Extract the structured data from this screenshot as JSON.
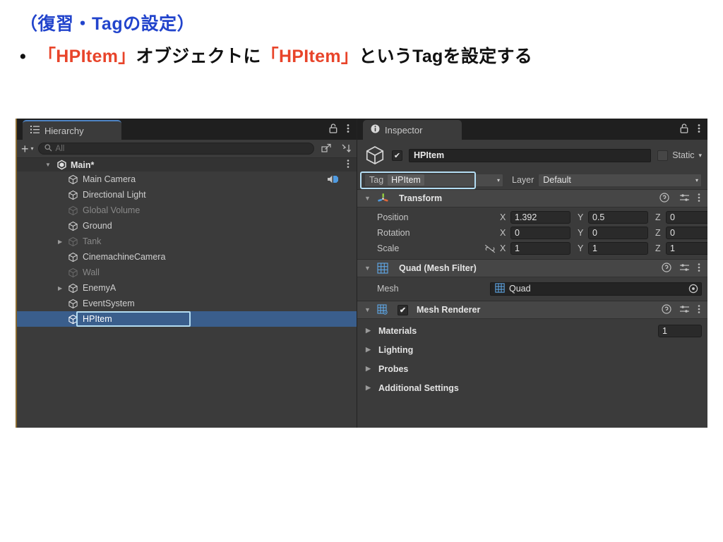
{
  "slide": {
    "title": "（復習・Tagの設定）",
    "bullet": {
      "marker": "•",
      "part1": "「HPItem」",
      "part2": "オブジェクトに",
      "part3": "「HPItem」",
      "part4": "というTagを設定する"
    },
    "colors": {
      "title": "#2244cc",
      "highlight": "#e8442a",
      "body": "#111111"
    }
  },
  "hierarchy": {
    "tab_label": "Hierarchy",
    "tab_icon": "list-icon",
    "lock_icon": "lock-icon",
    "menu_icon": "kebab-menu-icon",
    "add_button": "+",
    "add_caret": "▾",
    "search": {
      "icon": "search-icon",
      "placeholder": "All",
      "value": ""
    },
    "expand_icon": "expand-window-icon",
    "sort_icon": "sort-icon",
    "root": {
      "label": "Main*",
      "arrow": "▼",
      "kebab": "⋮"
    },
    "items": [
      {
        "label": "Main Camera",
        "arrow": "",
        "dim": false,
        "selected": false,
        "audio": true
      },
      {
        "label": "Directional Light",
        "arrow": "",
        "dim": false,
        "selected": false,
        "audio": false
      },
      {
        "label": "Global Volume",
        "arrow": "",
        "dim": true,
        "selected": false,
        "audio": false
      },
      {
        "label": "Ground",
        "arrow": "",
        "dim": false,
        "selected": false,
        "audio": false
      },
      {
        "label": "Tank",
        "arrow": "▶",
        "dim": true,
        "selected": false,
        "audio": false
      },
      {
        "label": "CinemachineCamera",
        "arrow": "",
        "dim": false,
        "selected": false,
        "audio": false
      },
      {
        "label": "Wall",
        "arrow": "",
        "dim": true,
        "selected": false,
        "audio": false
      },
      {
        "label": "EnemyA",
        "arrow": "▶",
        "dim": false,
        "selected": false,
        "audio": false
      },
      {
        "label": "EventSystem",
        "arrow": "",
        "dim": false,
        "selected": false,
        "audio": false
      },
      {
        "label": "HPItem",
        "arrow": "",
        "dim": false,
        "selected": true,
        "audio": false
      }
    ],
    "selection_color": "#3a5e8c",
    "highlight_outline": "#b3dcf2"
  },
  "inspector": {
    "tab_label": "Inspector",
    "tab_icon": "info-icon",
    "lock_icon": "lock-icon",
    "menu_icon": "kebab-menu-icon",
    "object": {
      "icon": "gameobject-cube-icon",
      "enabled": true,
      "check_glyph": "✔",
      "name": "HPItem",
      "static_label": "Static",
      "static_checked": false,
      "static_caret": "▾"
    },
    "tag_row": {
      "tag_label": "Tag",
      "tag_value": "HPItem",
      "tag_caret": "▾",
      "layer_label": "Layer",
      "layer_value": "Default",
      "layer_caret": "▾"
    },
    "components": [
      {
        "title": "Transform",
        "icon": "transform-axis-icon",
        "arrow": "▼",
        "has_checkbox": false,
        "help_icon": "help-icon",
        "preset_icon": "preset-icon",
        "menu_icon": "kebab-menu-icon",
        "rows": [
          {
            "label": "Position",
            "link": false,
            "x": "1.392",
            "y": "0.5",
            "z": "0"
          },
          {
            "label": "Rotation",
            "link": false,
            "x": "0",
            "y": "0",
            "z": "0"
          },
          {
            "label": "Scale",
            "link": true,
            "x": "1",
            "y": "1",
            "z": "1"
          }
        ],
        "axes": [
          "X",
          "Y",
          "Z"
        ]
      },
      {
        "title": "Quad (Mesh Filter)",
        "icon": "mesh-filter-icon",
        "arrow": "▼",
        "has_checkbox": false,
        "help_icon": "help-icon",
        "preset_icon": "preset-icon",
        "menu_icon": "kebab-menu-icon",
        "mesh_label": "Mesh",
        "mesh_value": "Quad",
        "mesh_value_icon": "mesh-filter-icon",
        "mesh_picker_icon": "object-picker-icon"
      },
      {
        "title": "Mesh Renderer",
        "icon": "mesh-renderer-icon",
        "arrow": "▼",
        "has_checkbox": true,
        "checked": true,
        "check_glyph": "✔",
        "help_icon": "help-icon",
        "preset_icon": "preset-icon",
        "menu_icon": "kebab-menu-icon",
        "sections": [
          {
            "label": "Materials",
            "arrow": "▶",
            "count": "1"
          },
          {
            "label": "Lighting",
            "arrow": "▶",
            "count": ""
          },
          {
            "label": "Probes",
            "arrow": "▶",
            "count": ""
          },
          {
            "label": "Additional Settings",
            "arrow": "▶",
            "count": ""
          }
        ]
      }
    ]
  }
}
